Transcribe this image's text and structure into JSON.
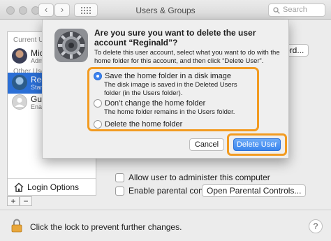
{
  "window": {
    "title": "Users & Groups",
    "search_placeholder": "Search",
    "nav_back": "‹",
    "nav_forward": "›",
    "grid_icon": "grid-icon"
  },
  "sidebar": {
    "current_users_label": "Current Us",
    "other_users_label": "Other Use",
    "users": [
      {
        "name": "Mich",
        "role": "Admi"
      },
      {
        "name": "Regi",
        "role": "Stan"
      },
      {
        "name": "Gue",
        "role": "Enab"
      }
    ],
    "login_options": "Login Options",
    "add_label": "+",
    "remove_label": "−"
  },
  "pane": {
    "password_button_fragment": "ord...",
    "allow_admin": "Allow user to administer this computer",
    "enable_parental": "Enable parental controls",
    "open_parental": "Open Parental Controls..."
  },
  "footer": {
    "lock_text": "Click the lock to prevent further changes.",
    "help": "?"
  },
  "dialog": {
    "title": "Are you sure you want to delete the user account “Reginald”?",
    "message": "To delete this user account, select what you want to do with the home folder for this account, and then click “Delete User”.",
    "options": [
      {
        "label": "Save the home folder in a disk image",
        "desc": "The disk image is saved in the Deleted Users folder (in the Users folder).",
        "selected": true
      },
      {
        "label": "Don’t change the home folder",
        "desc": "The home folder remains in the Users folder.",
        "selected": false
      },
      {
        "label": "Delete the home folder",
        "desc": "",
        "selected": false
      }
    ],
    "cancel": "Cancel",
    "delete": "Delete User"
  },
  "colors": {
    "highlight": "#f29b21",
    "accent": "#3a86ee"
  }
}
